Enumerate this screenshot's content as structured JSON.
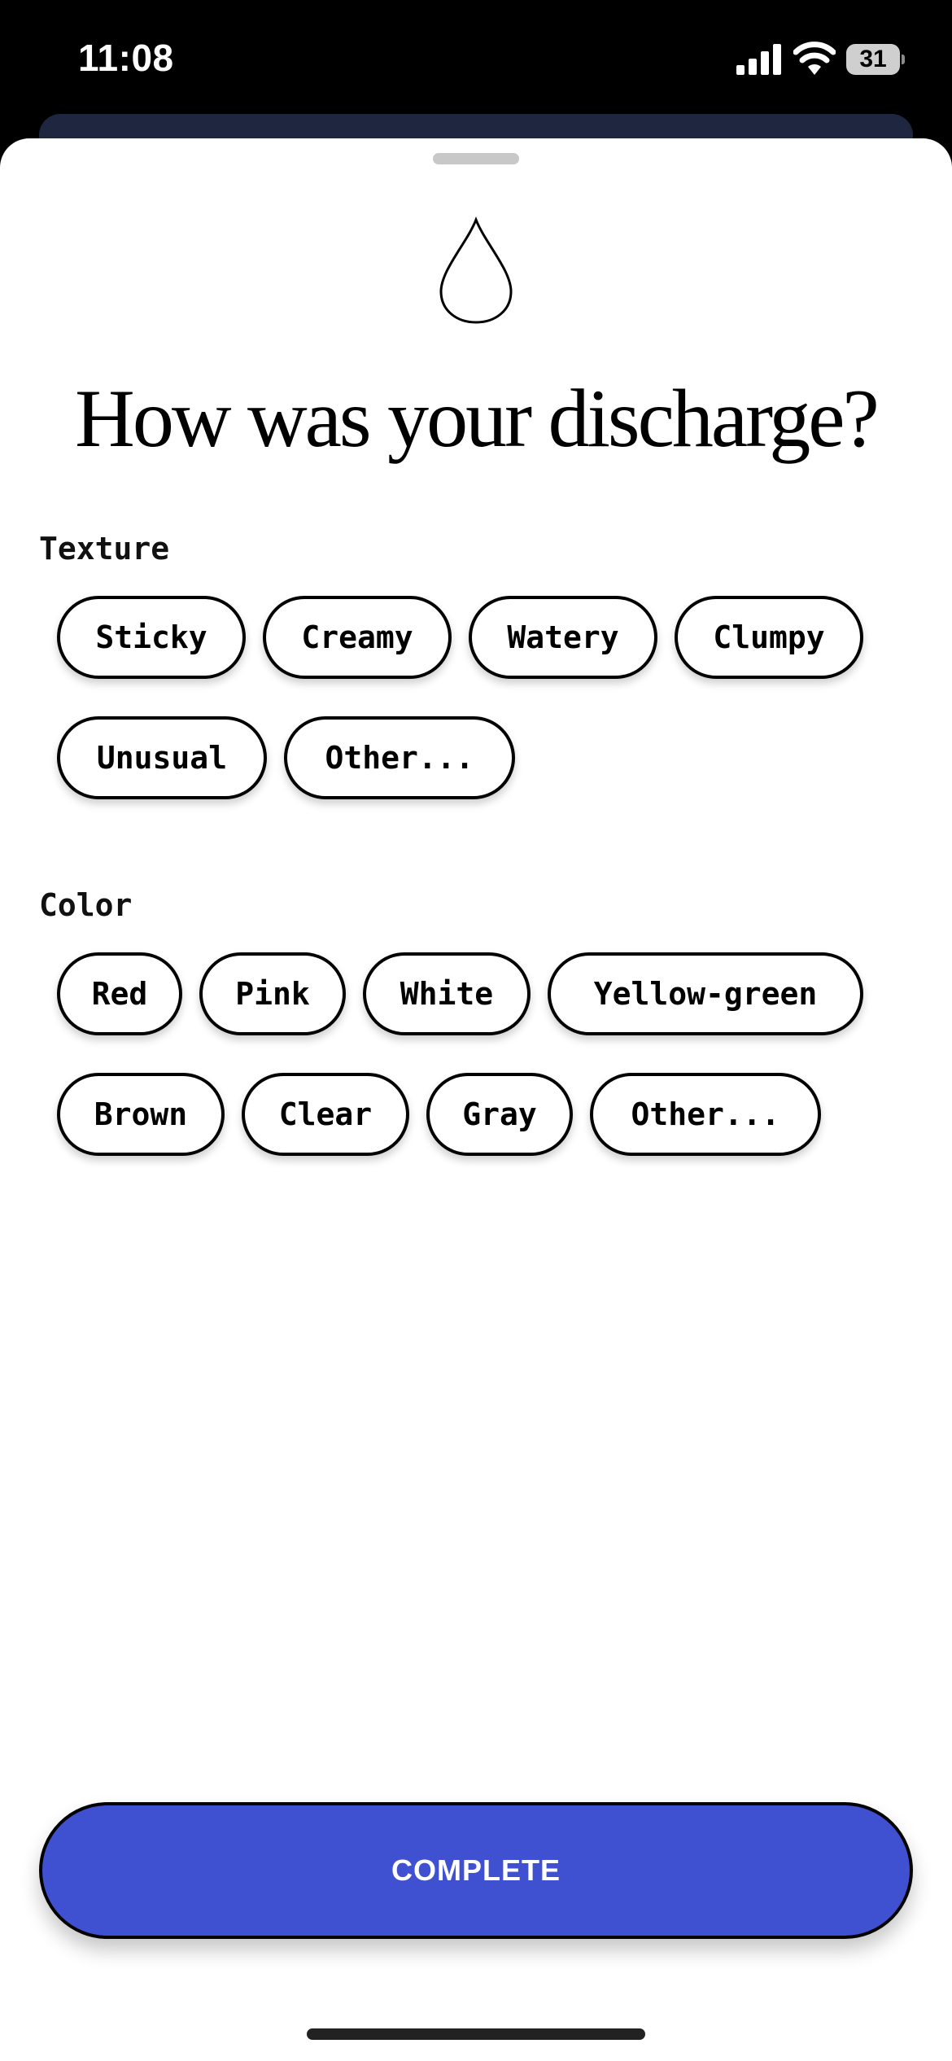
{
  "status_bar": {
    "time": "11:08",
    "battery": "31",
    "icons": [
      "signal-icon",
      "wifi-icon",
      "battery-icon"
    ]
  },
  "sheet": {
    "icon": "water-drop-icon",
    "title": "How was your discharge?"
  },
  "texture": {
    "label": "Texture",
    "options": [
      "Sticky",
      "Creamy",
      "Watery",
      "Clumpy",
      "Unusual",
      "Other..."
    ]
  },
  "color": {
    "label": "Color",
    "options": [
      "Red",
      "Pink",
      "White",
      "Yellow-green",
      "Brown",
      "Clear",
      "Gray",
      "Other..."
    ]
  },
  "complete_button": {
    "label": "COMPLETE",
    "color": "#3f51d1"
  }
}
